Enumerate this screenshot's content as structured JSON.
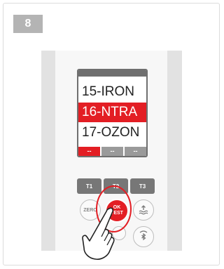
{
  "step": {
    "number": "8"
  },
  "screen": {
    "items": [
      "15-IRON",
      "16-NTRA",
      "17-OZON"
    ],
    "selected_index": 1,
    "softkeys": [
      "--",
      "--",
      "--"
    ]
  },
  "keypad": {
    "t1": "T1",
    "t2": "T2",
    "t3": "T3",
    "zero": "ZERO",
    "ok_line1": "OK",
    "ok_line2": "TEST"
  },
  "colors": {
    "accent": "#e31e24",
    "key_gray": "#777777",
    "badge_gray": "#b4b4b4"
  },
  "icons": [
    "tilde-arrow-icon",
    "bluetooth-icon",
    "pointing-hand-icon"
  ]
}
